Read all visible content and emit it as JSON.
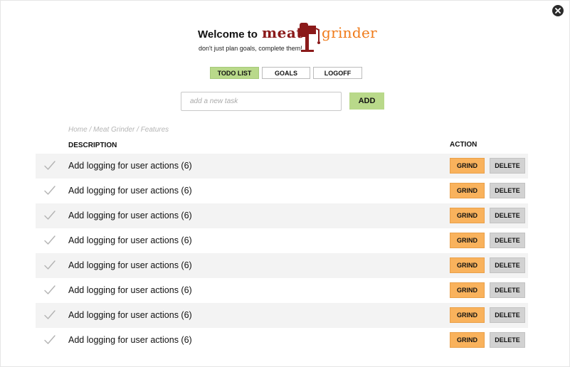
{
  "header": {
    "welcome": "Welcome to",
    "brand_meat": "meat",
    "brand_grinder": "grinder",
    "tagline": "don't just plan goals, complete them!",
    "brand_colors": {
      "meat": "#8b1a1a",
      "grinder": "#f07b1a"
    }
  },
  "nav": {
    "todo_label": "TODO LIST",
    "goals_label": "GOALS",
    "logoff_label": "LOGOFF",
    "active": "TODO LIST"
  },
  "new_task": {
    "placeholder": "add a new task",
    "value": "",
    "add_label": "ADD"
  },
  "breadcrumb": "Home / Meat Grinder / Features",
  "table": {
    "col_description": "DESCRIPTION",
    "col_action": "ACTION",
    "grind_label": "GRIND",
    "delete_label": "DELETE",
    "rows": [
      {
        "description": "Add logging for user actions (6)"
      },
      {
        "description": "Add logging for user actions (6)"
      },
      {
        "description": "Add logging for user actions (6)"
      },
      {
        "description": "Add logging for user actions (6)"
      },
      {
        "description": "Add logging for user actions (6)"
      },
      {
        "description": "Add logging for user actions (6)"
      },
      {
        "description": "Add logging for user actions (6)"
      },
      {
        "description": "Add logging for user actions (6)"
      }
    ]
  },
  "icons": {
    "close": "close-icon",
    "check": "check-icon",
    "logo": "meat-grinder-logo"
  },
  "colors": {
    "accent_green": "#b9d98a",
    "grind_orange": "#f9b25c",
    "delete_gray": "#d2d2d2",
    "row_stripe": "#f3f3f3"
  }
}
